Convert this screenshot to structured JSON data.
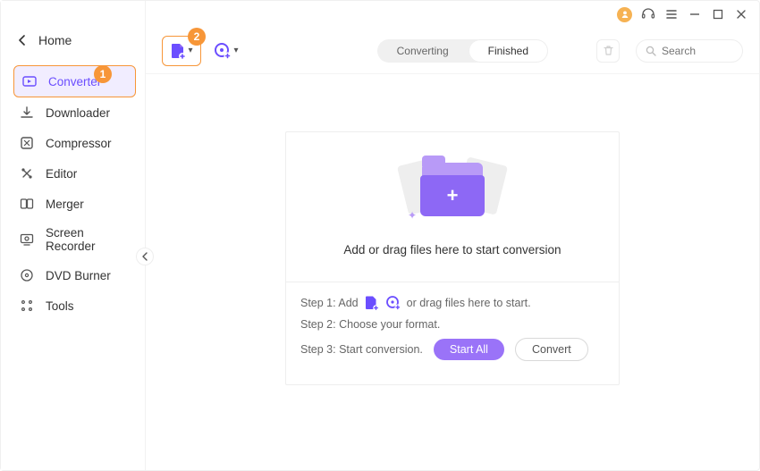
{
  "callouts": {
    "one": "1",
    "two": "2"
  },
  "sidebar": {
    "home": "Home",
    "items": [
      {
        "label": "Converter"
      },
      {
        "label": "Downloader"
      },
      {
        "label": "Compressor"
      },
      {
        "label": "Editor"
      },
      {
        "label": "Merger"
      },
      {
        "label": "Screen Recorder"
      },
      {
        "label": "DVD Burner"
      },
      {
        "label": "Tools"
      }
    ]
  },
  "toolbar": {
    "tabs": {
      "converting": "Converting",
      "finished": "Finished"
    },
    "search_placeholder": "Search"
  },
  "drop": {
    "title": "Add or drag files here to start conversion",
    "step1a": "Step 1: Add",
    "step1b": "or drag files here to start.",
    "step2": "Step 2: Choose your format.",
    "step3": "Step 3: Start conversion.",
    "start_all": "Start All",
    "convert": "Convert"
  }
}
